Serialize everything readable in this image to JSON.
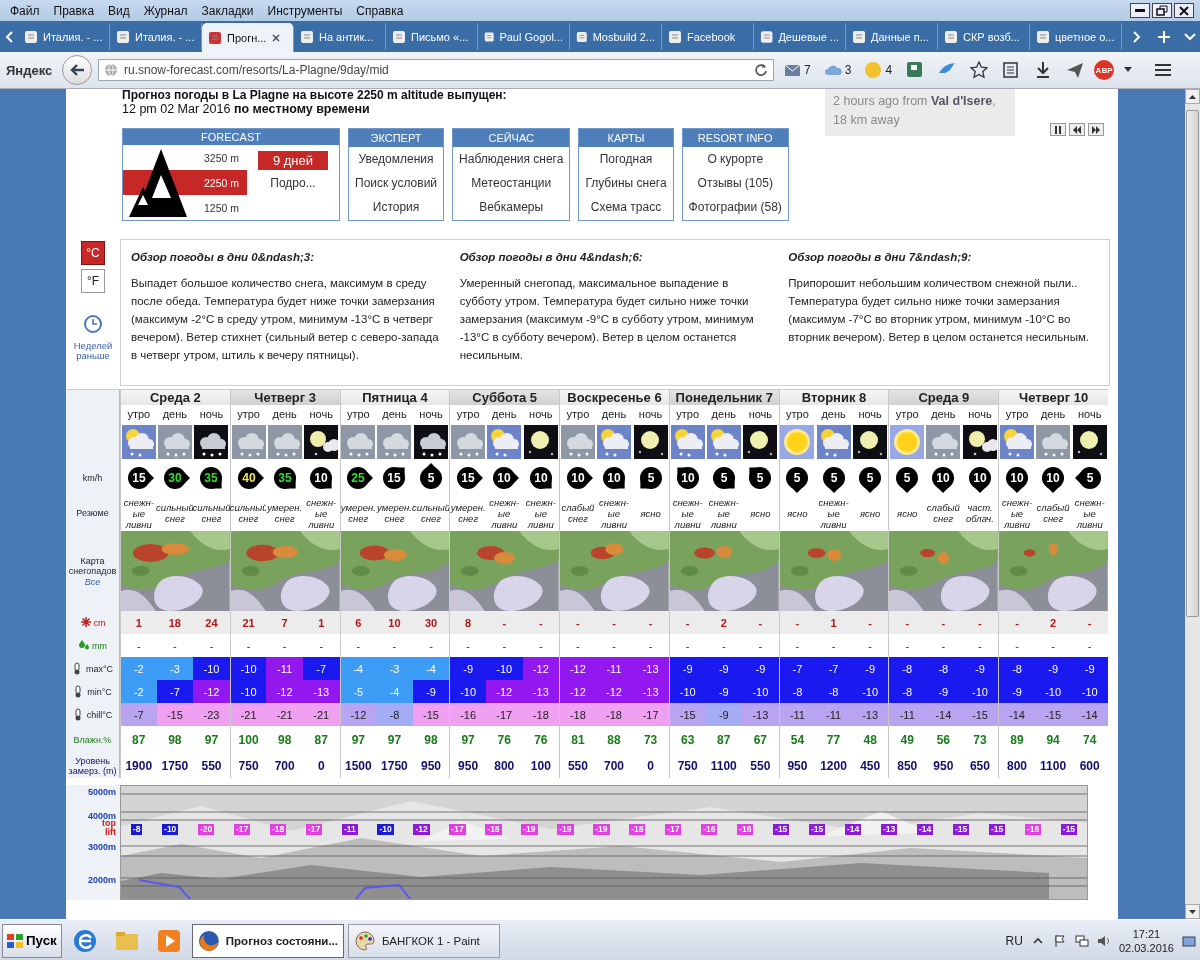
{
  "browser": {
    "menu": [
      "Файл",
      "Правка",
      "Вид",
      "Журнал",
      "Закладки",
      "Инструменты",
      "Справка"
    ],
    "tabs": [
      {
        "label": "Италия. - ...",
        "selected": false
      },
      {
        "label": "Италия. - ...",
        "selected": false
      },
      {
        "label": "Прогн...",
        "selected": true
      },
      {
        "label": "На антик...",
        "selected": false
      },
      {
        "label": "Письмо «...",
        "selected": false
      },
      {
        "label": "Paul Gogol...",
        "selected": false
      },
      {
        "label": "Mosbuild 2...",
        "selected": false
      },
      {
        "label": "Facebook",
        "selected": false
      },
      {
        "label": "Дешевые ...",
        "selected": false
      },
      {
        "label": "Данные п...",
        "selected": false
      },
      {
        "label": "СКР возб...",
        "selected": false
      },
      {
        "label": "цветное о...",
        "selected": false
      }
    ],
    "brand": "Яндекс",
    "url": "ru.snow-forecast.com/resorts/La-Plagne/9day/mid",
    "badges": [
      {
        "kind": "mail",
        "count": "7"
      },
      {
        "kind": "cloud",
        "count": "3"
      },
      {
        "kind": "counter",
        "count": "4"
      }
    ],
    "adblock": "ABP"
  },
  "page": {
    "heading": "Прогноз погоды в La Plagne на высоте 2250 m altitude выпущен:",
    "issued": "12 pm  02 Mar 2016 **по местному времени**",
    "report": {
      "prefix": "2 hours ago from ",
      "link": "Val d'Isere",
      "suffix": ", 18 km away"
    },
    "forecast_menu": {
      "title": "FORECAST",
      "elevations": [
        {
          "label": "3250 m",
          "selected": false
        },
        {
          "label": "2250 m",
          "selected": true
        },
        {
          "label": "1250 m",
          "selected": false
        }
      ],
      "days_button": "9 дней",
      "more_link": "Подро..."
    },
    "menus": [
      {
        "title": "ЭКСПЕРТ",
        "items": [
          "Уведомления",
          "Поиск условий",
          "История"
        ]
      },
      {
        "title": "СЕЙЧАС",
        "items": [
          "Наблюдения снега",
          "Метеостанции",
          "Вебкамеры"
        ]
      },
      {
        "title": "КАРТЫ",
        "items": [
          "Погодная",
          "Глубины снега",
          "Схема трасс"
        ]
      },
      {
        "title": "RESORT INFO",
        "items": [
          "О курорте",
          "Отзывы (105)",
          "Фотографии (58)"
        ]
      }
    ],
    "units": [
      {
        "label": "°C",
        "selected": true
      },
      {
        "label": "°F",
        "selected": false
      }
    ],
    "earlier_link": "Неделей раньше",
    "overview": [
      {
        "title": "Обзор погоды в дни 0&ndash;3:",
        "text": "Выпадет большое количество снега, максимум в среду после обеда. Температура будет ниже точки замерзания (максимум -2°C в среду утром, минимум -13°C в четверг вечером). Ветер стихнет (сильный ветер с северо-запада в четверг утром, штиль к вечеру пятницы)."
      },
      {
        "title": "Обзор погоды в дни 4&ndash;6:",
        "text": "Умеренный снегопад, максимальное выпадение в субботу утром. Температура будет сильно ниже точки замерзания (максимум -9°C в субботу утром, минимум -13°C в субботу вечером). Ветер в целом останется несильным."
      },
      {
        "title": "Обзор погоды в дни 7&ndash;9:",
        "text": "Припорошит небольшим количеством снежной пыли.. Температура будет сильно ниже точки замерзания (максимум -7°C во вторник утром, минимум -10°C во вторник вечером). Ветер в целом останется несильным."
      }
    ]
  },
  "table": {
    "row_labels": {
      "wind": "km/h",
      "summary": "Резюме",
      "map": "Карта снегопадов",
      "map_link": "Все",
      "snow": "cm",
      "rain": "mm",
      "max": "max°C",
      "min": "min°C",
      "chill": "chill°C",
      "humidity": "Влажн.%",
      "freezing": "Уровень замерз. (m)"
    },
    "days": [
      {
        "name": "Среда 2",
        "periods": [
          {
            "label": "утро",
            "kind": "sun-snow",
            "wind": {
              "speed": "15",
              "color": "#ffffff",
              "kind": "E"
            },
            "summary": "снежн-ые ливни",
            "snow": "1",
            "rain": "-",
            "max": {
              "value": "-2",
              "color": "#3d9cf5"
            },
            "min": {
              "value": "-2",
              "color": "#3d9cf5"
            },
            "chill": {
              "value": "-7",
              "color": "#b8a4f0"
            },
            "humidity": "87",
            "freezing": "1900"
          },
          {
            "label": "день",
            "kind": "snow",
            "wind": {
              "speed": "30",
              "color": "#33dd33",
              "kind": "E"
            },
            "summary": "сильный снег",
            "snow": "18",
            "rain": "-",
            "max": {
              "value": "-3",
              "color": "#3d9cf5"
            },
            "min": {
              "value": "-7",
              "color": "#1a1af0"
            },
            "chill": {
              "value": "-15",
              "color": "#f0a0f0"
            },
            "humidity": "98",
            "freezing": "1750"
          },
          {
            "label": "ночь",
            "kind": "night-snow",
            "wind": {
              "speed": "35",
              "color": "#33dd33",
              "kind": "SE"
            },
            "summary": "сильный снег",
            "snow": "24",
            "rain": "-",
            "max": {
              "value": "-10",
              "color": "#1a1af0"
            },
            "min": {
              "value": "-12",
              "color": "#9318f0"
            },
            "chill": {
              "value": "-23",
              "color": "#f0a0f0"
            },
            "humidity": "97",
            "freezing": "550"
          }
        ]
      },
      {
        "name": "Четверг 3",
        "periods": [
          {
            "label": "утро",
            "kind": "snow",
            "wind": {
              "speed": "40",
              "color": "#f0e850",
              "kind": "E"
            },
            "summary": "сильный снег",
            "snow": "21",
            "rain": "-",
            "max": {
              "value": "-10",
              "color": "#1a1af0"
            },
            "min": {
              "value": "-10",
              "color": "#1a1af0"
            },
            "chill": {
              "value": "-21",
              "color": "#f0a0f0"
            },
            "humidity": "100",
            "freezing": "750"
          },
          {
            "label": "день",
            "kind": "snow",
            "wind": {
              "speed": "35",
              "color": "#33dd33",
              "kind": "SE"
            },
            "summary": "умерен. снег",
            "snow": "7",
            "rain": "-",
            "max": {
              "value": "-11",
              "color": "#9318f0"
            },
            "min": {
              "value": "-12",
              "color": "#9318f0"
            },
            "chill": {
              "value": "-21",
              "color": "#f0a0f0"
            },
            "humidity": "98",
            "freezing": "700"
          },
          {
            "label": "ночь",
            "kind": "moon-cloud",
            "wind": {
              "speed": "10",
              "color": "#ffffff",
              "kind": "SE"
            },
            "summary": "снежн-ые ливни",
            "snow": "1",
            "rain": "-",
            "max": {
              "value": "-7",
              "color": "#1a1af0"
            },
            "min": {
              "value": "-13",
              "color": "#9318f0"
            },
            "chill": {
              "value": "-21",
              "color": "#f0a0f0"
            },
            "humidity": "87",
            "freezing": "0"
          }
        ]
      },
      {
        "name": "Пятница 4",
        "periods": [
          {
            "label": "утро",
            "kind": "snow",
            "wind": {
              "speed": "25",
              "color": "#33dd33",
              "kind": "E"
            },
            "summary": "умерен. снег",
            "snow": "6",
            "rain": "-",
            "max": {
              "value": "-4",
              "color": "#3d9cf5"
            },
            "min": {
              "value": "-5",
              "color": "#3d9cf5"
            },
            "chill": {
              "value": "-12",
              "color": "#b8a4f0"
            },
            "humidity": "97",
            "freezing": "1500"
          },
          {
            "label": "день",
            "kind": "snow",
            "wind": {
              "speed": "15",
              "color": "#ffffff",
              "kind": "NE"
            },
            "summary": "умерен. снег",
            "snow": "10",
            "rain": "-",
            "max": {
              "value": "-3",
              "color": "#3d9cf5"
            },
            "min": {
              "value": "-4",
              "color": "#3d9cf5"
            },
            "chill": {
              "value": "-8",
              "color": "#a4acf5"
            },
            "humidity": "97",
            "freezing": "1750"
          },
          {
            "label": "ночь",
            "kind": "night-snow",
            "wind": {
              "speed": "5",
              "color": "#ffffff",
              "kind": "N"
            },
            "summary": "сильный снег",
            "snow": "30",
            "rain": "-",
            "max": {
              "value": "-4",
              "color": "#3d9cf5"
            },
            "min": {
              "value": "-9",
              "color": "#1a1af0"
            },
            "chill": {
              "value": "-15",
              "color": "#f0a0f0"
            },
            "humidity": "98",
            "freezing": "950"
          }
        ]
      },
      {
        "name": "Суббота 5",
        "periods": [
          {
            "label": "утро",
            "kind": "snow",
            "wind": {
              "speed": "15",
              "color": "#ffffff",
              "kind": "E"
            },
            "summary": "умерен. снег",
            "snow": "8",
            "rain": "-",
            "max": {
              "value": "-9",
              "color": "#1a1af0"
            },
            "min": {
              "value": "-10",
              "color": "#1a1af0"
            },
            "chill": {
              "value": "-16",
              "color": "#f0a0f0"
            },
            "humidity": "97",
            "freezing": "950"
          },
          {
            "label": "день",
            "kind": "sun-snow",
            "wind": {
              "speed": "10",
              "color": "#ffffff",
              "kind": "E"
            },
            "summary": "снежн-ые ливни",
            "snow": "-",
            "rain": "-",
            "max": {
              "value": "-10",
              "color": "#1a1af0"
            },
            "min": {
              "value": "-12",
              "color": "#9318f0"
            },
            "chill": {
              "value": "-17",
              "color": "#f0a0f0"
            },
            "humidity": "76",
            "freezing": "800"
          },
          {
            "label": "ночь",
            "kind": "moon",
            "wind": {
              "speed": "10",
              "color": "#ffffff",
              "kind": "SE"
            },
            "summary": "снежн-ые ливни",
            "snow": "-",
            "rain": "-",
            "max": {
              "value": "-12",
              "color": "#9318f0"
            },
            "min": {
              "value": "-13",
              "color": "#9318f0"
            },
            "chill": {
              "value": "-18",
              "color": "#f0a0f0"
            },
            "humidity": "76",
            "freezing": "100"
          }
        ]
      },
      {
        "name": "Воскресенье 6",
        "periods": [
          {
            "label": "утро",
            "kind": "snow",
            "wind": {
              "speed": "10",
              "color": "#ffffff",
              "kind": "E"
            },
            "summary": "слабый снег",
            "snow": "-",
            "rain": "-",
            "max": {
              "value": "-12",
              "color": "#9318f0"
            },
            "min": {
              "value": "-12",
              "color": "#9318f0"
            },
            "chill": {
              "value": "-18",
              "color": "#f0a0f0"
            },
            "humidity": "81",
            "freezing": "550"
          },
          {
            "label": "день",
            "kind": "sun-snow",
            "wind": {
              "speed": "10",
              "color": "#ffffff",
              "kind": "SE"
            },
            "summary": "снежн-ые ливни",
            "snow": "-",
            "rain": "-",
            "max": {
              "value": "-11",
              "color": "#9318f0"
            },
            "min": {
              "value": "-12",
              "color": "#9318f0"
            },
            "chill": {
              "value": "-18",
              "color": "#f0a0f0"
            },
            "humidity": "88",
            "freezing": "700"
          },
          {
            "label": "ночь",
            "kind": "moon",
            "wind": {
              "speed": "5",
              "color": "#ffffff",
              "kind": "SW"
            },
            "summary": "ясно",
            "snow": "-",
            "rain": "-",
            "max": {
              "value": "-13",
              "color": "#9318f0"
            },
            "min": {
              "value": "-13",
              "color": "#9318f0"
            },
            "chill": {
              "value": "-17",
              "color": "#f0a0f0"
            },
            "humidity": "73",
            "freezing": "0"
          }
        ]
      },
      {
        "name": "Понедельник 7",
        "periods": [
          {
            "label": "утро",
            "kind": "sun-snow",
            "wind": {
              "speed": "10",
              "color": "#ffffff",
              "kind": "NW"
            },
            "summary": "снежн-ые ливни",
            "snow": "-",
            "rain": "-",
            "max": {
              "value": "-9",
              "color": "#1a1af0"
            },
            "min": {
              "value": "-10",
              "color": "#1a1af0"
            },
            "chill": {
              "value": "-15",
              "color": "#b8a4f0"
            },
            "humidity": "63",
            "freezing": "750"
          },
          {
            "label": "день",
            "kind": "sun-snow",
            "wind": {
              "speed": "5",
              "color": "#ffffff",
              "kind": "SE"
            },
            "summary": "снежн-ые ливни",
            "snow": "2",
            "rain": "-",
            "max": {
              "value": "-9",
              "color": "#1a1af0"
            },
            "min": {
              "value": "-9",
              "color": "#1a1af0"
            },
            "chill": {
              "value": "-9",
              "color": "#a4acf5"
            },
            "humidity": "87",
            "freezing": "1100"
          },
          {
            "label": "ночь",
            "kind": "moon",
            "wind": {
              "speed": "5",
              "color": "#ffffff",
              "kind": "NW"
            },
            "summary": "ясно",
            "snow": "-",
            "rain": "-",
            "max": {
              "value": "-9",
              "color": "#1a1af0"
            },
            "min": {
              "value": "-10",
              "color": "#1a1af0"
            },
            "chill": {
              "value": "-13",
              "color": "#b8a4f0"
            },
            "humidity": "67",
            "freezing": "550"
          }
        ]
      },
      {
        "name": "Вторник 8",
        "periods": [
          {
            "label": "утро",
            "kind": "sun",
            "wind": {
              "speed": "5",
              "color": "#ffffff",
              "kind": "S"
            },
            "summary": "ясно",
            "snow": "-",
            "rain": "-",
            "max": {
              "value": "-7",
              "color": "#1a1af0"
            },
            "min": {
              "value": "-8",
              "color": "#1a1af0"
            },
            "chill": {
              "value": "-11",
              "color": "#b8a4f0"
            },
            "humidity": "54",
            "freezing": "950"
          },
          {
            "label": "день",
            "kind": "sun-snow",
            "wind": {
              "speed": "5",
              "color": "#ffffff",
              "kind": "S"
            },
            "summary": "снежн-ые ливни",
            "snow": "1",
            "rain": "-",
            "max": {
              "value": "-7",
              "color": "#1a1af0"
            },
            "min": {
              "value": "-8",
              "color": "#1a1af0"
            },
            "chill": {
              "value": "-11",
              "color": "#b8a4f0"
            },
            "humidity": "77",
            "freezing": "1200"
          },
          {
            "label": "ночь",
            "kind": "moon",
            "wind": {
              "speed": "5",
              "color": "#ffffff",
              "kind": "S"
            },
            "summary": "ясно",
            "snow": "-",
            "rain": "-",
            "max": {
              "value": "-9",
              "color": "#1a1af0"
            },
            "min": {
              "value": "-10",
              "color": "#1a1af0"
            },
            "chill": {
              "value": "-13",
              "color": "#b8a4f0"
            },
            "humidity": "48",
            "freezing": "450"
          }
        ]
      },
      {
        "name": "Среда 9",
        "periods": [
          {
            "label": "утро",
            "kind": "sun",
            "wind": {
              "speed": "5",
              "color": "#ffffff",
              "kind": "S"
            },
            "summary": "ясно",
            "snow": "-",
            "rain": "-",
            "max": {
              "value": "-8",
              "color": "#1a1af0"
            },
            "min": {
              "value": "-8",
              "color": "#1a1af0"
            },
            "chill": {
              "value": "-11",
              "color": "#b8a4f0"
            },
            "humidity": "49",
            "freezing": "850"
          },
          {
            "label": "день",
            "kind": "snow",
            "wind": {
              "speed": "10",
              "color": "#ffffff",
              "kind": "S"
            },
            "summary": "слабый снег",
            "snow": "-",
            "rain": "-",
            "max": {
              "value": "-8",
              "color": "#1a1af0"
            },
            "min": {
              "value": "-9",
              "color": "#1a1af0"
            },
            "chill": {
              "value": "-14",
              "color": "#b8a4f0"
            },
            "humidity": "56",
            "freezing": "950"
          },
          {
            "label": "ночь",
            "kind": "moon-cloud",
            "wind": {
              "speed": "10",
              "color": "#ffffff",
              "kind": "S"
            },
            "summary": "част. облач.",
            "snow": "-",
            "rain": "-",
            "max": {
              "value": "-9",
              "color": "#1a1af0"
            },
            "min": {
              "value": "-10",
              "color": "#1a1af0"
            },
            "chill": {
              "value": "-15",
              "color": "#b8a4f0"
            },
            "humidity": "73",
            "freezing": "650"
          }
        ]
      },
      {
        "name": "Четверг 10",
        "periods": [
          {
            "label": "утро",
            "kind": "sun-snow",
            "wind": {
              "speed": "10",
              "color": "#ffffff",
              "kind": "S"
            },
            "summary": "снежн-ые ливни",
            "snow": "-",
            "rain": "-",
            "max": {
              "value": "-8",
              "color": "#1a1af0"
            },
            "min": {
              "value": "-9",
              "color": "#1a1af0"
            },
            "chill": {
              "value": "-14",
              "color": "#b8a4f0"
            },
            "humidity": "89",
            "freezing": "800"
          },
          {
            "label": "день",
            "kind": "snow",
            "wind": {
              "speed": "10",
              "color": "#ffffff",
              "kind": "S"
            },
            "summary": "слабый снег",
            "snow": "2",
            "rain": "-",
            "max": {
              "value": "-9",
              "color": "#1a1af0"
            },
            "min": {
              "value": "-10",
              "color": "#1a1af0"
            },
            "chill": {
              "value": "-15",
              "color": "#b8a4f0"
            },
            "humidity": "94",
            "freezing": "1100"
          },
          {
            "label": "ночь",
            "kind": "moon",
            "wind": {
              "speed": "5",
              "color": "#ffffff",
              "kind": "W"
            },
            "summary": "снежн-ые ливни",
            "snow": "-",
            "rain": "-",
            "max": {
              "value": "-9",
              "color": "#1a1af0"
            },
            "min": {
              "value": "-10",
              "color": "#1a1af0"
            },
            "chill": {
              "value": "-14",
              "color": "#b8a4f0"
            },
            "humidity": "74",
            "freezing": "600"
          }
        ]
      }
    ]
  },
  "freezing_chart": {
    "y_labels": [
      "5000m",
      "4000m",
      "3000m",
      "2000m"
    ],
    "top_lift": "top lift",
    "top_lift_temps": [
      {
        "value": "-8",
        "color": "#1a1ad0"
      },
      {
        "value": "-10",
        "color": "#1a1ad0"
      },
      {
        "value": "-20",
        "color": "#e040e0"
      },
      {
        "value": "-17",
        "color": "#e040e0"
      },
      {
        "value": "-18",
        "color": "#e040e0"
      },
      {
        "value": "-17",
        "color": "#e040e0"
      },
      {
        "value": "-11",
        "color": "#8a1ad8"
      },
      {
        "value": "-10",
        "color": "#1a1ad0"
      },
      {
        "value": "-12",
        "color": "#8a1ad8"
      },
      {
        "value": "-17",
        "color": "#e040e0"
      },
      {
        "value": "-18",
        "color": "#e040e0"
      },
      {
        "value": "-19",
        "color": "#e040e0"
      },
      {
        "value": "-19",
        "color": "#e040e0"
      },
      {
        "value": "-19",
        "color": "#e040e0"
      },
      {
        "value": "-18",
        "color": "#e040e0"
      },
      {
        "value": "-17",
        "color": "#e040e0"
      },
      {
        "value": "-16",
        "color": "#e040e0"
      },
      {
        "value": "-16",
        "color": "#e040e0"
      },
      {
        "value": "-15",
        "color": "#8a1ad8"
      },
      {
        "value": "-15",
        "color": "#8a1ad8"
      },
      {
        "value": "-14",
        "color": "#8a1ad8"
      },
      {
        "value": "-13",
        "color": "#8a1ad8"
      },
      {
        "value": "-14",
        "color": "#8a1ad8"
      },
      {
        "value": "-15",
        "color": "#8a1ad8"
      },
      {
        "value": "-15",
        "color": "#8a1ad8"
      },
      {
        "value": "-16",
        "color": "#e040e0"
      },
      {
        "value": "-15",
        "color": "#8a1ad8"
      }
    ]
  },
  "taskbar": {
    "start": "Пуск",
    "apps": [
      {
        "kind": "browser",
        "label": "Прогноз состояни...",
        "selected": true
      },
      {
        "kind": "paint",
        "label": "БАНГКОК 1 - Paint",
        "selected": false
      }
    ],
    "language": "RU",
    "time": "17:21",
    "date": "02.03.2016"
  }
}
